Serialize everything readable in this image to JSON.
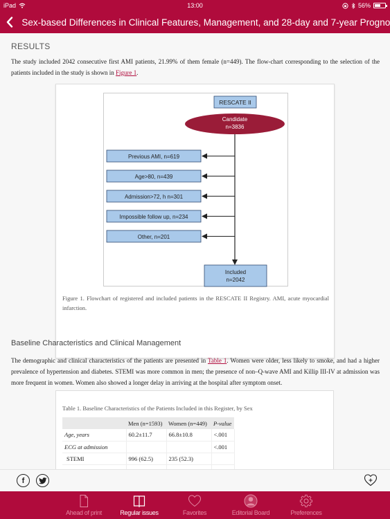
{
  "status_bar": {
    "device": "iPad",
    "time": "13:00",
    "battery_percent": "56%",
    "battery_level": 0.56
  },
  "header": {
    "back_icon": "chevron-left-icon",
    "title": "Sex-based Differences in Clinical Features, Management, and 28-day and 7-year Progno..."
  },
  "article": {
    "results_heading": "RESULTS",
    "results_paragraph": {
      "before_link": "The study included 2042 consecutive first AMI patients, 21.99% of them female (n=449). The flow-chart corresponding to the selection of the patients included in the study is shown in ",
      "link": "Figure 1",
      "after_link": "."
    },
    "figure": {
      "top_box": "RESCATE II",
      "candidate_line1": "Candidate",
      "candidate_line2": "n=3836",
      "exclusions": [
        "Previous AMI, n=619",
        "Age>80, n=439",
        "Admission>72, h n=301",
        "Impossible follow up, n=234",
        "Other, n=201"
      ],
      "included_line1": "Included",
      "included_line2": "n=2042",
      "caption": "Figure 1. Flowchart of registered and included patients in the RESCATE II Registry. AMI, acute myocardial infarction."
    },
    "baseline_heading": "Baseline Characteristics and Clinical Management",
    "baseline_paragraph": {
      "before_link": "The demographic and clinical characteristics of the patients are presented in ",
      "link": "Table 1",
      "after_link": ". Women were older, less likely to smoke, and had a higher prevalence of hypertension and diabetes. STEMI was more common in men; the presence of non–Q-wave AMI and Killip III-IV at admission was more frequent in women. Women also showed a longer delay in arriving at the hospital after symptom onset."
    },
    "table": {
      "title": "Table 1. Baseline Characteristics of the Patients Included in this Register, by Sex",
      "headers": [
        "",
        "Men (n=1593)",
        "Women (n=449)",
        "P-value"
      ],
      "rows": [
        [
          "Age, years",
          "60.2±11.7",
          "66.8±10.8",
          "<.001"
        ],
        [
          "ECG at admission",
          "",
          "",
          "<.001"
        ],
        [
          "STEMI",
          "996 (62.5)",
          "235 (52.3)",
          ""
        ]
      ]
    }
  },
  "share_bar": {
    "facebook_glyph": "f",
    "twitter_icon": "twitter-icon",
    "add_favorite_icon": "heart-plus-icon"
  },
  "tab_bar": {
    "tabs": [
      {
        "label": "Ahead of print",
        "icon": "document-icon",
        "active": false
      },
      {
        "label": "Regular issues",
        "icon": "book-icon",
        "active": true
      },
      {
        "label": "Favorites",
        "icon": "heart-icon",
        "active": false
      },
      {
        "label": "Editorial Board",
        "icon": "user-icon",
        "active": false
      },
      {
        "label": "Preferences",
        "icon": "gear-icon",
        "active": false
      }
    ]
  },
  "colors": {
    "brand": "#b00b3c",
    "flow_box_fill": "#a9c9ea",
    "flow_box_stroke": "#2f4a72",
    "ellipse_fill": "#9a1c38",
    "inactive_tab": "#e48aa3"
  }
}
